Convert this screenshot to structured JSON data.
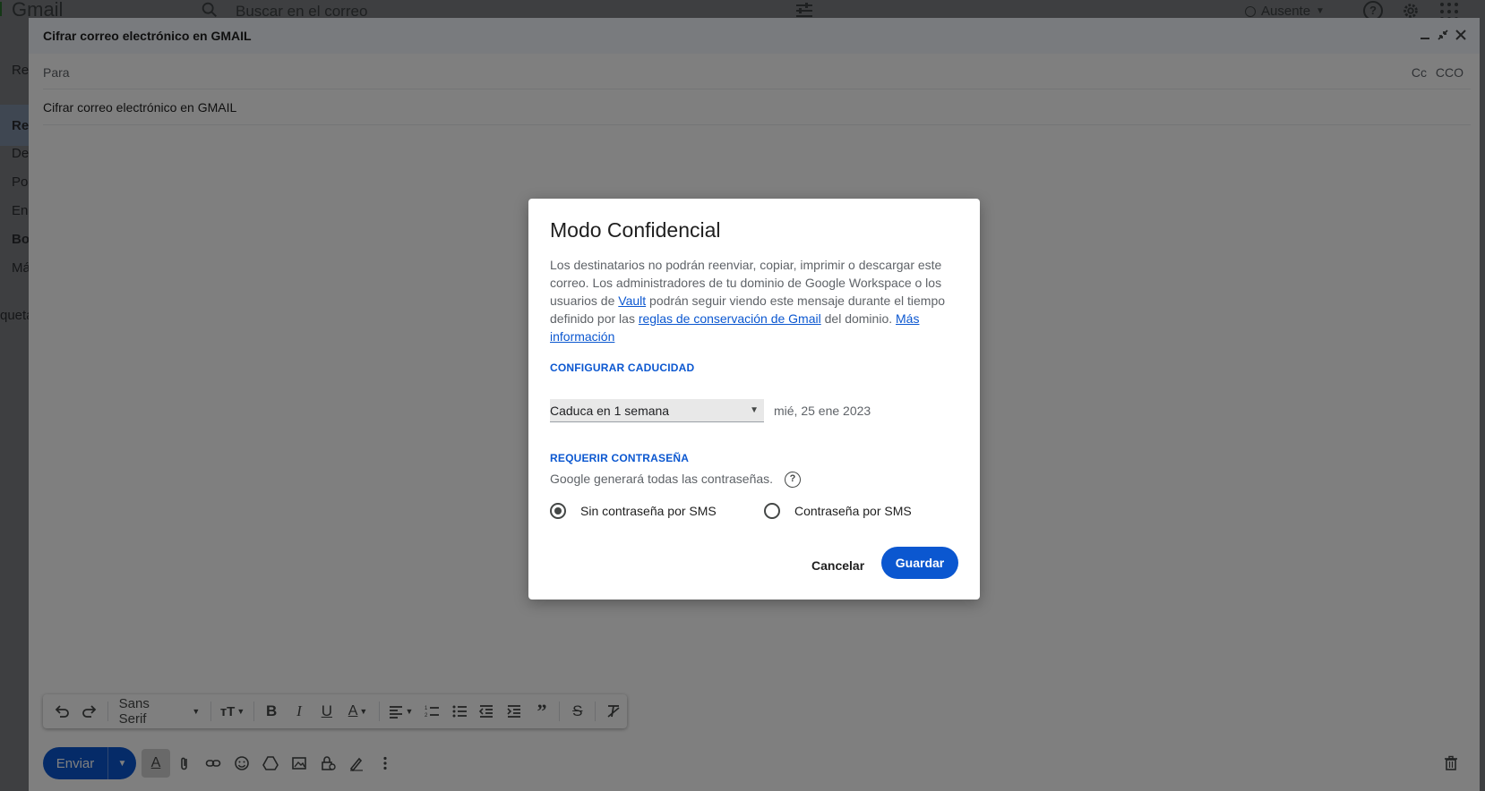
{
  "background": {
    "app_name": "Gmail",
    "search_placeholder": "Buscar en el correo",
    "status_label": "Ausente",
    "nav_fragments": [
      "Re",
      "Re",
      "De",
      "Po",
      "En",
      "Bo",
      "Má",
      "queta"
    ]
  },
  "compose": {
    "title": "Cifrar correo electrónico en GMAIL",
    "to_label": "Para",
    "cc_label": "Cc",
    "bcc_label": "CCO",
    "subject": "Cifrar correo electrónico en GMAIL"
  },
  "toolbar": {
    "font_name": "Sans Serif"
  },
  "bottom": {
    "send_label": "Enviar"
  },
  "dialog": {
    "title": "Modo Confidencial",
    "body_1": "Los destinatarios no podrán reenviar, copiar, imprimir o descargar este correo. Los administradores de tu dominio de Google Workspace o los usuarios de ",
    "vault_link": "Vault",
    "body_2": " podrán seguir viendo este mensaje durante el tiempo definido por las ",
    "retention_link": "reglas de conservación de Gmail",
    "body_3": " del dominio. ",
    "more_info_link": "Más información",
    "expiry_section": "CONFIGURAR CADUCIDAD",
    "expiry_value": "Caduca en 1 semana",
    "expiry_date": "mié, 25 ene 2023",
    "password_section": "REQUERIR CONTRASEÑA",
    "password_note": "Google generará todas las contraseñas.",
    "option_no_sms": "Sin contraseña por SMS",
    "option_sms": "Contraseña por SMS",
    "selected_option": "Sin contraseña por SMS",
    "cancel_label": "Cancelar",
    "save_label": "Guardar"
  },
  "colors": {
    "accent": "#0b57d0",
    "scrim": "rgba(0,0,0,0.5)"
  }
}
